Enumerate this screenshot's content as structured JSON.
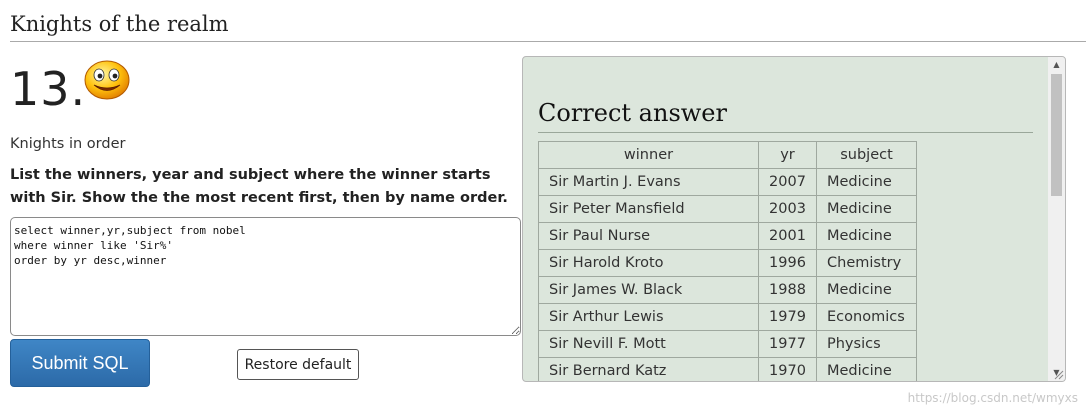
{
  "section": {
    "title": "Knights of the realm"
  },
  "question": {
    "number": "13.",
    "subheading": "Knights in order",
    "instructions": "List the winners, year and subject where the winner starts with Sir. Show the the most recent first, then by name order."
  },
  "editor": {
    "value": "select winner,yr,subject from nobel\nwhere winner like 'Sir%'\norder by yr desc,winner"
  },
  "buttons": {
    "submit_label": "Submit SQL",
    "restore_label": "Restore default"
  },
  "answer": {
    "title": "Correct answer",
    "columns": [
      "winner",
      "yr",
      "subject"
    ],
    "rows": [
      [
        "Sir Martin J. Evans",
        "2007",
        "Medicine"
      ],
      [
        "Sir Peter Mansfield",
        "2003",
        "Medicine"
      ],
      [
        "Sir Paul Nurse",
        "2001",
        "Medicine"
      ],
      [
        "Sir Harold Kroto",
        "1996",
        "Chemistry"
      ],
      [
        "Sir James W. Black",
        "1988",
        "Medicine"
      ],
      [
        "Sir Arthur Lewis",
        "1979",
        "Economics"
      ],
      [
        "Sir Nevill F. Mott",
        "1977",
        "Physics"
      ],
      [
        "Sir Bernard Katz",
        "1970",
        "Medicine"
      ]
    ]
  },
  "icons": {
    "status": "smiley-icon",
    "scroll_up": "arrow-up-icon",
    "scroll_down": "arrow-down-icon"
  },
  "colors": {
    "panel_bg": "#dce6dc",
    "submit_bg": "#2f70ad"
  },
  "watermark": "https://blog.csdn.net/wmyxs"
}
